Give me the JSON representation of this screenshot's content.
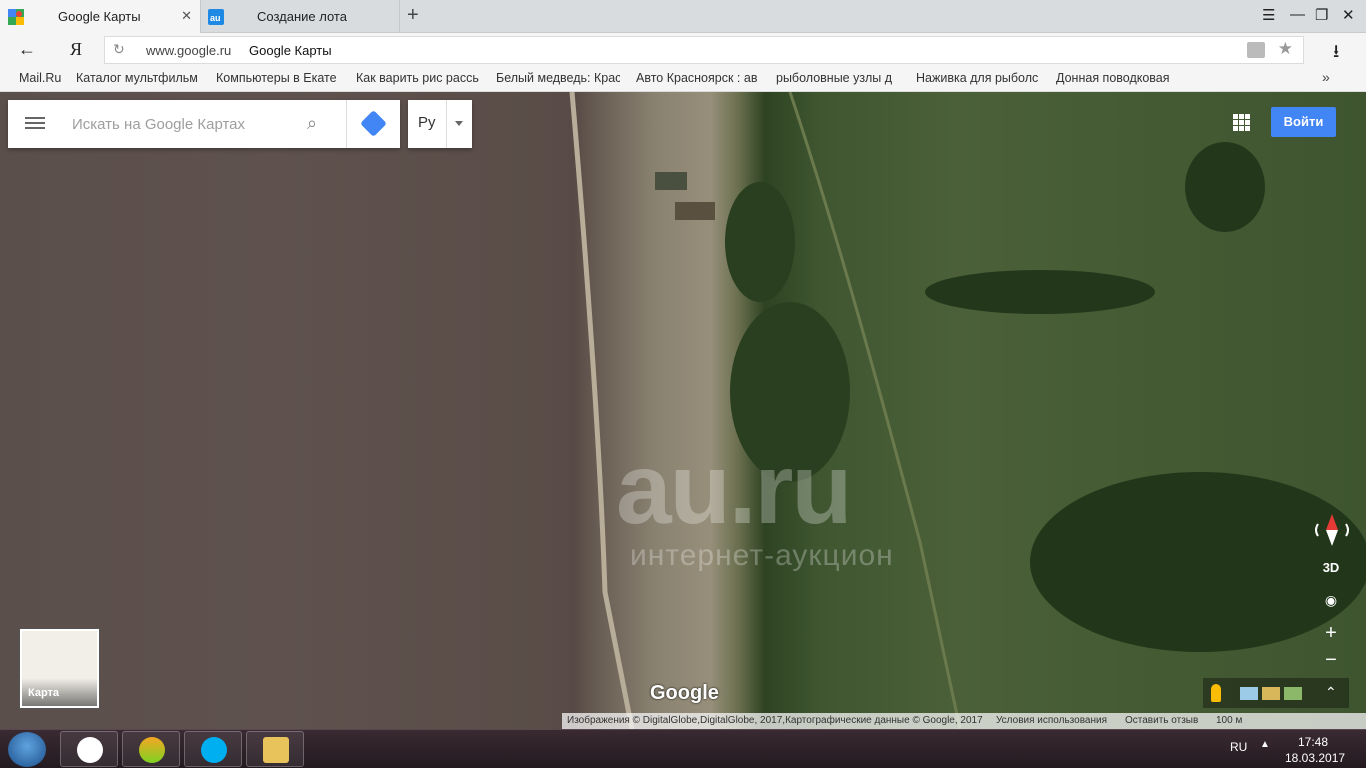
{
  "tabs": [
    {
      "label": "Google Карты",
      "active": true
    },
    {
      "label": "Создание лота",
      "active": false
    }
  ],
  "address": {
    "host": "www.google.ru",
    "title": "Google Карты"
  },
  "bookmarks": [
    "Mail.Ru",
    "Каталог мультфильм",
    "Компьютеры в Екате",
    "Как варить рис рассь",
    "Белый медведь: Крас",
    "Авто Красноярск : ав",
    "рыболовные узлы д",
    "Наживка для рыболс",
    "Донная поводковая"
  ],
  "search": {
    "placeholder": "Искать на Google Картах"
  },
  "lang": "Ру",
  "login_label": "Войти",
  "minimap_label": "Карта",
  "google_watermark": "Google",
  "au_logo": "au.ru",
  "au_sub": "интернет-аукцион",
  "controls": {
    "tilt": "3D"
  },
  "footer": {
    "attribution": "Изображения © DigitalGlobe,DigitalGlobe, 2017,Картографические данные © Google, 2017",
    "terms": "Условия использования",
    "feedback": "Оставить отзыв",
    "scale": "100 м"
  },
  "tray": {
    "lang": "RU",
    "time": "17:48",
    "date": "18.03.2017"
  },
  "colors": {
    "accent": "#4285f4",
    "compass_red": "#e53935"
  }
}
